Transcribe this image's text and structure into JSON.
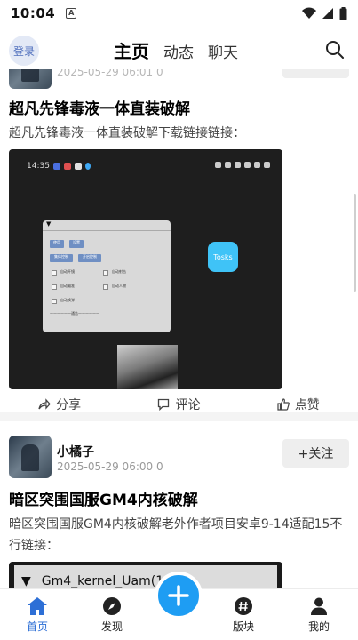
{
  "status_bar": {
    "time": "10:04",
    "a_icon": "A"
  },
  "header": {
    "login_label": "登录",
    "tabs": [
      {
        "label": "主页",
        "active": true
      },
      {
        "label": "动态",
        "active": false
      },
      {
        "label": "聊天",
        "active": false
      }
    ]
  },
  "posts": [
    {
      "time": "2025-05-29 06:01 0",
      "title": "超凡先锋毒液一体直装破解",
      "desc": "超凡先锋毒液一体直装破解下载链接链接：",
      "image": {
        "clock": "14:35",
        "dialog_buttons": [
          "使用",
          "设置",
          "集体控制",
          "开启控制"
        ],
        "dialog_options": [
          "自动开镜",
          "自动射击",
          "自动瞄准",
          "自动人物",
          "自动换弹"
        ],
        "dialog_footer": "——————通告——————",
        "floating_button": "Tosks"
      },
      "actions": {
        "share": "分享",
        "comment": "评论",
        "like": "点赞"
      }
    },
    {
      "author": "小橘子",
      "time": "2025-05-29 06:00 0",
      "follow_label": "+关注",
      "title": "暗区突围国服GM4内核破解",
      "desc": "暗区突围国服GM4内核破解老外作者项目安卓9-14适配15不行链接：",
      "image": {
        "window_title": "Gm4_kernel_Uam(1004)"
      }
    }
  ],
  "bottom_nav": [
    {
      "label": "首页",
      "icon": "home-icon",
      "active": true
    },
    {
      "label": "发现",
      "icon": "compass-icon",
      "active": false
    },
    {
      "label": "版块",
      "icon": "hashtag-icon",
      "active": false
    },
    {
      "label": "我的",
      "icon": "user-icon",
      "active": false
    }
  ],
  "colors": {
    "accent": "#2d6fd6",
    "fab": "#1e9df3",
    "follow_bg": "#eeeeee"
  }
}
